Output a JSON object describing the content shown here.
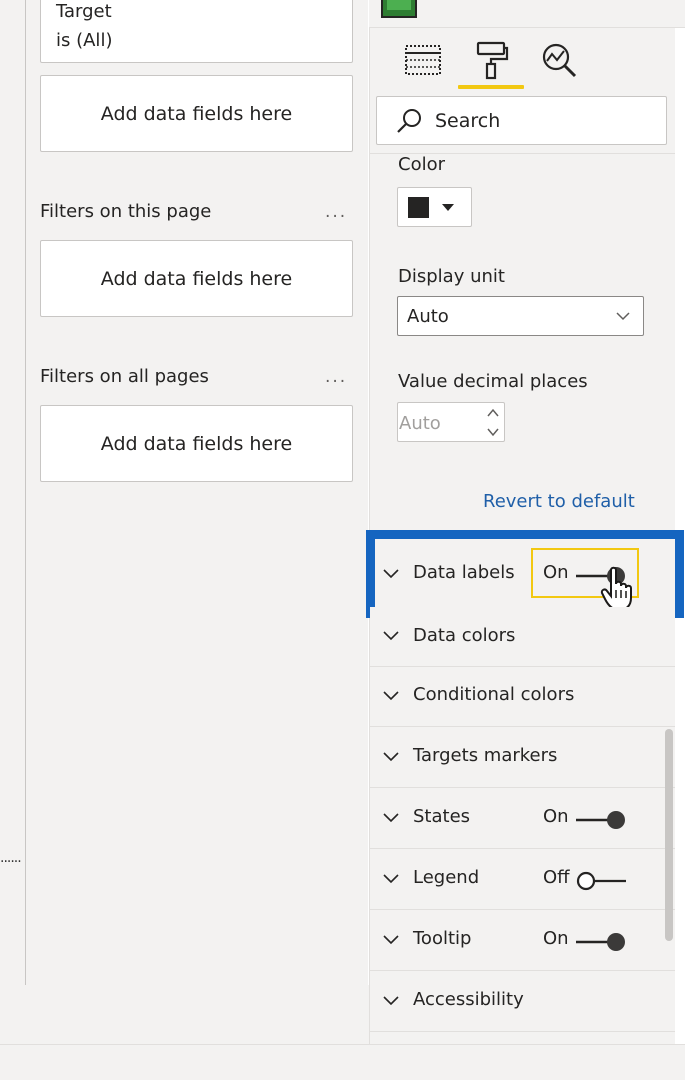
{
  "filters": {
    "target_card": {
      "line1": "Target",
      "line2": "is (All)"
    },
    "visual_drop_text": "Add data fields here",
    "page_section": {
      "label": "Filters on this page",
      "more": "...",
      "drop_text": "Add data fields here"
    },
    "all_pages_section": {
      "label": "Filters on all pages",
      "more": "...",
      "drop_text": "Add data fields here"
    },
    "edge_dots": "......"
  },
  "format_pane": {
    "tabs": [
      {
        "name": "fields",
        "icon": "table-fields-icon"
      },
      {
        "name": "format",
        "icon": "paint-roller-icon",
        "active": true
      },
      {
        "name": "analytics",
        "icon": "analytics-magnifier-icon"
      }
    ],
    "search": {
      "placeholder": "Search",
      "value": ""
    },
    "color": {
      "label": "Color",
      "value": "#252423"
    },
    "display_unit": {
      "label": "Display unit",
      "value": "Auto"
    },
    "value_decimal_places": {
      "label": "Value decimal places",
      "value": "Auto"
    },
    "revert_label": "Revert to default",
    "cards": [
      {
        "label": "Data labels",
        "toggle": "On"
      },
      {
        "label": "Data colors"
      },
      {
        "label": "Conditional colors"
      },
      {
        "label": "Targets markers"
      },
      {
        "label": "States",
        "toggle": "On"
      },
      {
        "label": "Legend",
        "toggle": "Off"
      },
      {
        "label": "Tooltip",
        "toggle": "On"
      },
      {
        "label": "Accessibility"
      }
    ]
  },
  "colors": {
    "highlight_frame": "#1565c0",
    "toggle_focus": "#f2c811",
    "active_tab_underline": "#f2c811",
    "link": "#1f5fa8"
  }
}
